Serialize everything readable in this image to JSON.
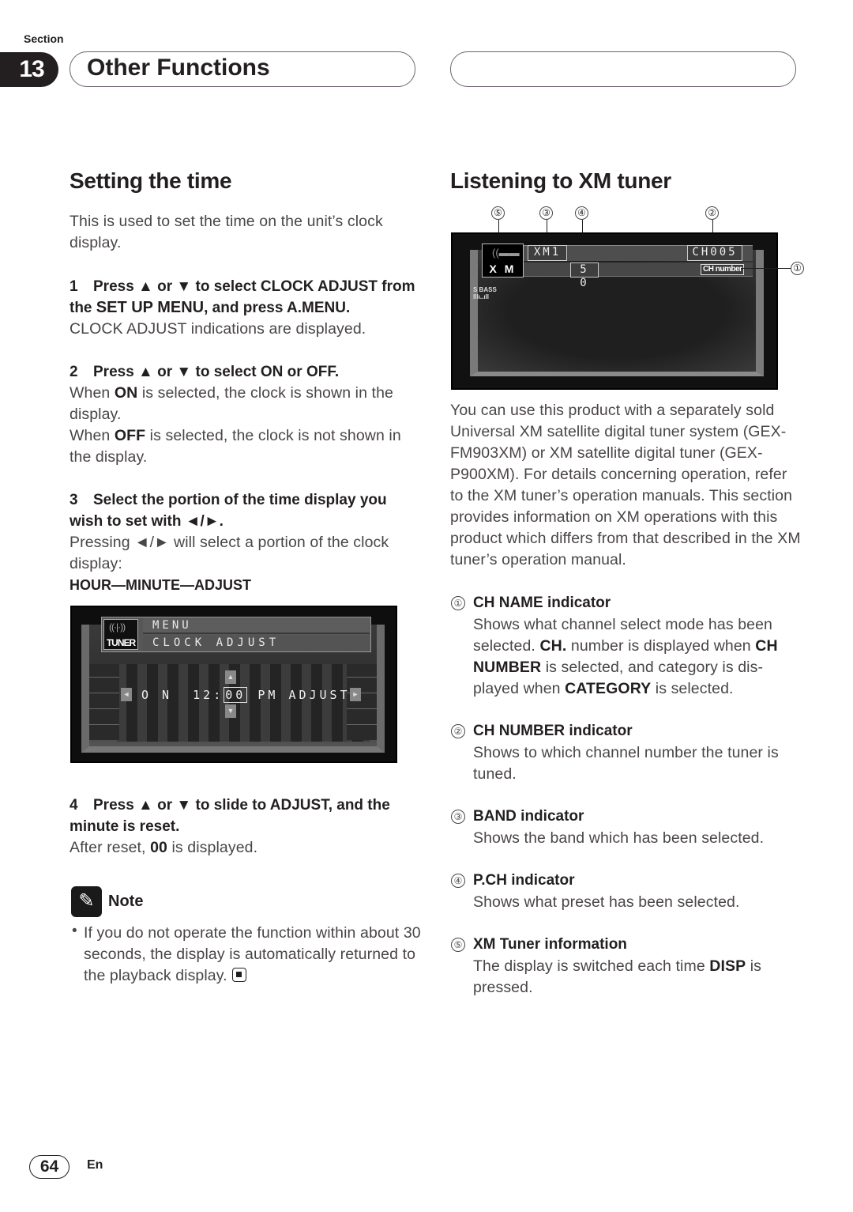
{
  "header": {
    "section_label": "Section",
    "section_number": "13",
    "chapter_title": "Other Functions"
  },
  "left": {
    "heading": "Setting the time",
    "intro": "This is used to set the time on the unit’s clock display.",
    "steps": [
      {
        "number": "1",
        "head_parts": [
          "Press ",
          "▲",
          " or ",
          "▼",
          " to select ",
          "CLOCK ADJUST",
          " from the ",
          "SET UP MENU",
          ", and press ",
          "A.MENU",
          "."
        ],
        "body": "CLOCK ADJUST indications are displayed."
      },
      {
        "number": "2",
        "head_parts": [
          "Press ",
          "▲",
          " or ",
          "▼",
          " to select ",
          "ON",
          " or ",
          "OFF",
          "."
        ],
        "body_lines": [
          {
            "pre": "When ",
            "bold": "ON",
            "post": " is selected, the clock is shown in the display."
          },
          {
            "pre": "When ",
            "bold": "OFF",
            "post": " is selected, the clock is not shown in the display."
          }
        ]
      },
      {
        "number": "3",
        "head": "Select the portion of the time display you wish to set with ◄/►.",
        "body": "Pressing ◄/► will select a portion of the clock display:",
        "sequence": "HOUR—MINUTE—ADJUST"
      },
      {
        "number": "4",
        "head": "Press ▲ or ▼ to slide to ADJUST, and the minute is reset.",
        "body_pre": "After reset, ",
        "body_bold": "00",
        "body_post": " is displayed."
      }
    ],
    "clock_screen": {
      "logo": "TUNER",
      "menu": "MENU",
      "submenu": "CLOCK ADJUST",
      "on": "O N",
      "hour": "12:",
      "minute": "00",
      "ampm": "PM",
      "adjust": "ADJUST",
      "left_arrow": "◄",
      "right_arrow": "►",
      "up_arrow": "▲",
      "down_arrow": "▼"
    },
    "note": {
      "icon": "pencil-icon",
      "label": "Note",
      "bullet": "•",
      "text": "If you do not operate the function within about 30 seconds, the display is automatically returned to the playback display."
    }
  },
  "right": {
    "heading": "Listening to XM tuner",
    "xm_screen": {
      "logo": "X M",
      "band": "XM1",
      "preset": "5 0",
      "channel": "CH005",
      "ch_name": "CH number",
      "sbass": "S BASS",
      "sbass_meter": "Illı..ıll"
    },
    "callouts": [
      "①",
      "②",
      "③",
      "④",
      "⑤"
    ],
    "intro": "You can use this product with a separately sold Universal XM satellite digital tuner system (GEX-FM903XM) or XM satellite digital tuner (GEX-P900XM). For details concerning operation, refer to the XM tuner’s operation manuals. This section provides information on XM operations with this product which differs from that described in the  XM tuner’s operation manual.",
    "items": [
      {
        "num": "①",
        "head_bold": "CH NAME",
        "head_rest": " indicator",
        "body_html_parts": [
          "Shows what channel select mode has been selected. ",
          "CH.",
          " number is displayed when ",
          "CH NUMBER",
          " is selected, and category is dis-played when ",
          "CATEGORY",
          " is selected."
        ]
      },
      {
        "num": "②",
        "head_bold": "CH NUMBER",
        "head_rest": " indicator",
        "body": "Shows to which channel number the tuner is tuned."
      },
      {
        "num": "③",
        "head_bold": "BAND",
        "head_rest": " indicator",
        "body": "Shows the band which has been selected."
      },
      {
        "num": "④",
        "head_bold": "P.CH",
        "head_rest": " indicator",
        "body": "Shows what preset has been selected."
      },
      {
        "num": "⑤",
        "head_bold": "XM Tuner information",
        "head_rest": "",
        "body_pre": "The display is switched each time ",
        "body_bold": "DISP",
        "body_post": " is pressed."
      }
    ]
  },
  "footer": {
    "page_number": "64",
    "language": "En"
  }
}
